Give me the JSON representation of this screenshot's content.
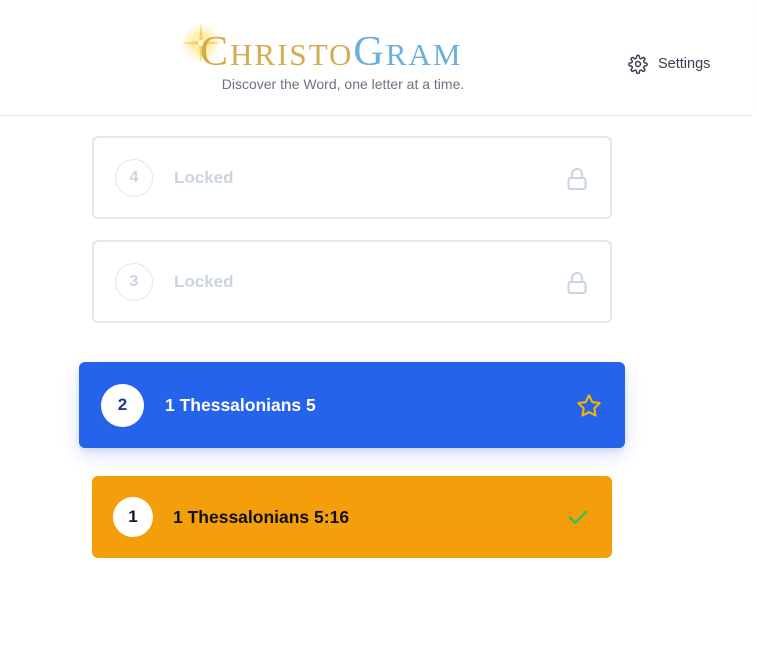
{
  "header": {
    "brand": {
      "part1_initial": "C",
      "part1_rest": "HRISTO",
      "part2_initial": "G",
      "part2_rest": "RAM"
    },
    "tagline": "Discover the Word, one letter at a time.",
    "settings_label": "Settings",
    "settings_icon": "gear-icon"
  },
  "levels": [
    {
      "number": "4",
      "label": "Locked",
      "status": "locked",
      "icon": "lock-icon"
    },
    {
      "number": "3",
      "label": "Locked",
      "status": "locked",
      "icon": "lock-icon"
    },
    {
      "number": "2",
      "label": "1 Thessalonians 5",
      "status": "active",
      "icon": "star-icon"
    },
    {
      "number": "1",
      "label": "1 Thessalonians 5:16",
      "status": "completed",
      "icon": "check-icon"
    }
  ],
  "colors": {
    "active": "#2563eb",
    "completed": "#f59e0b",
    "locked_border": "#e5e7eb",
    "locked_text": "#cbd5e1",
    "brand_gold": "#d6ab4f",
    "brand_blue": "#6ab0dc",
    "check": "#22c55e",
    "star": "#f5b400"
  }
}
